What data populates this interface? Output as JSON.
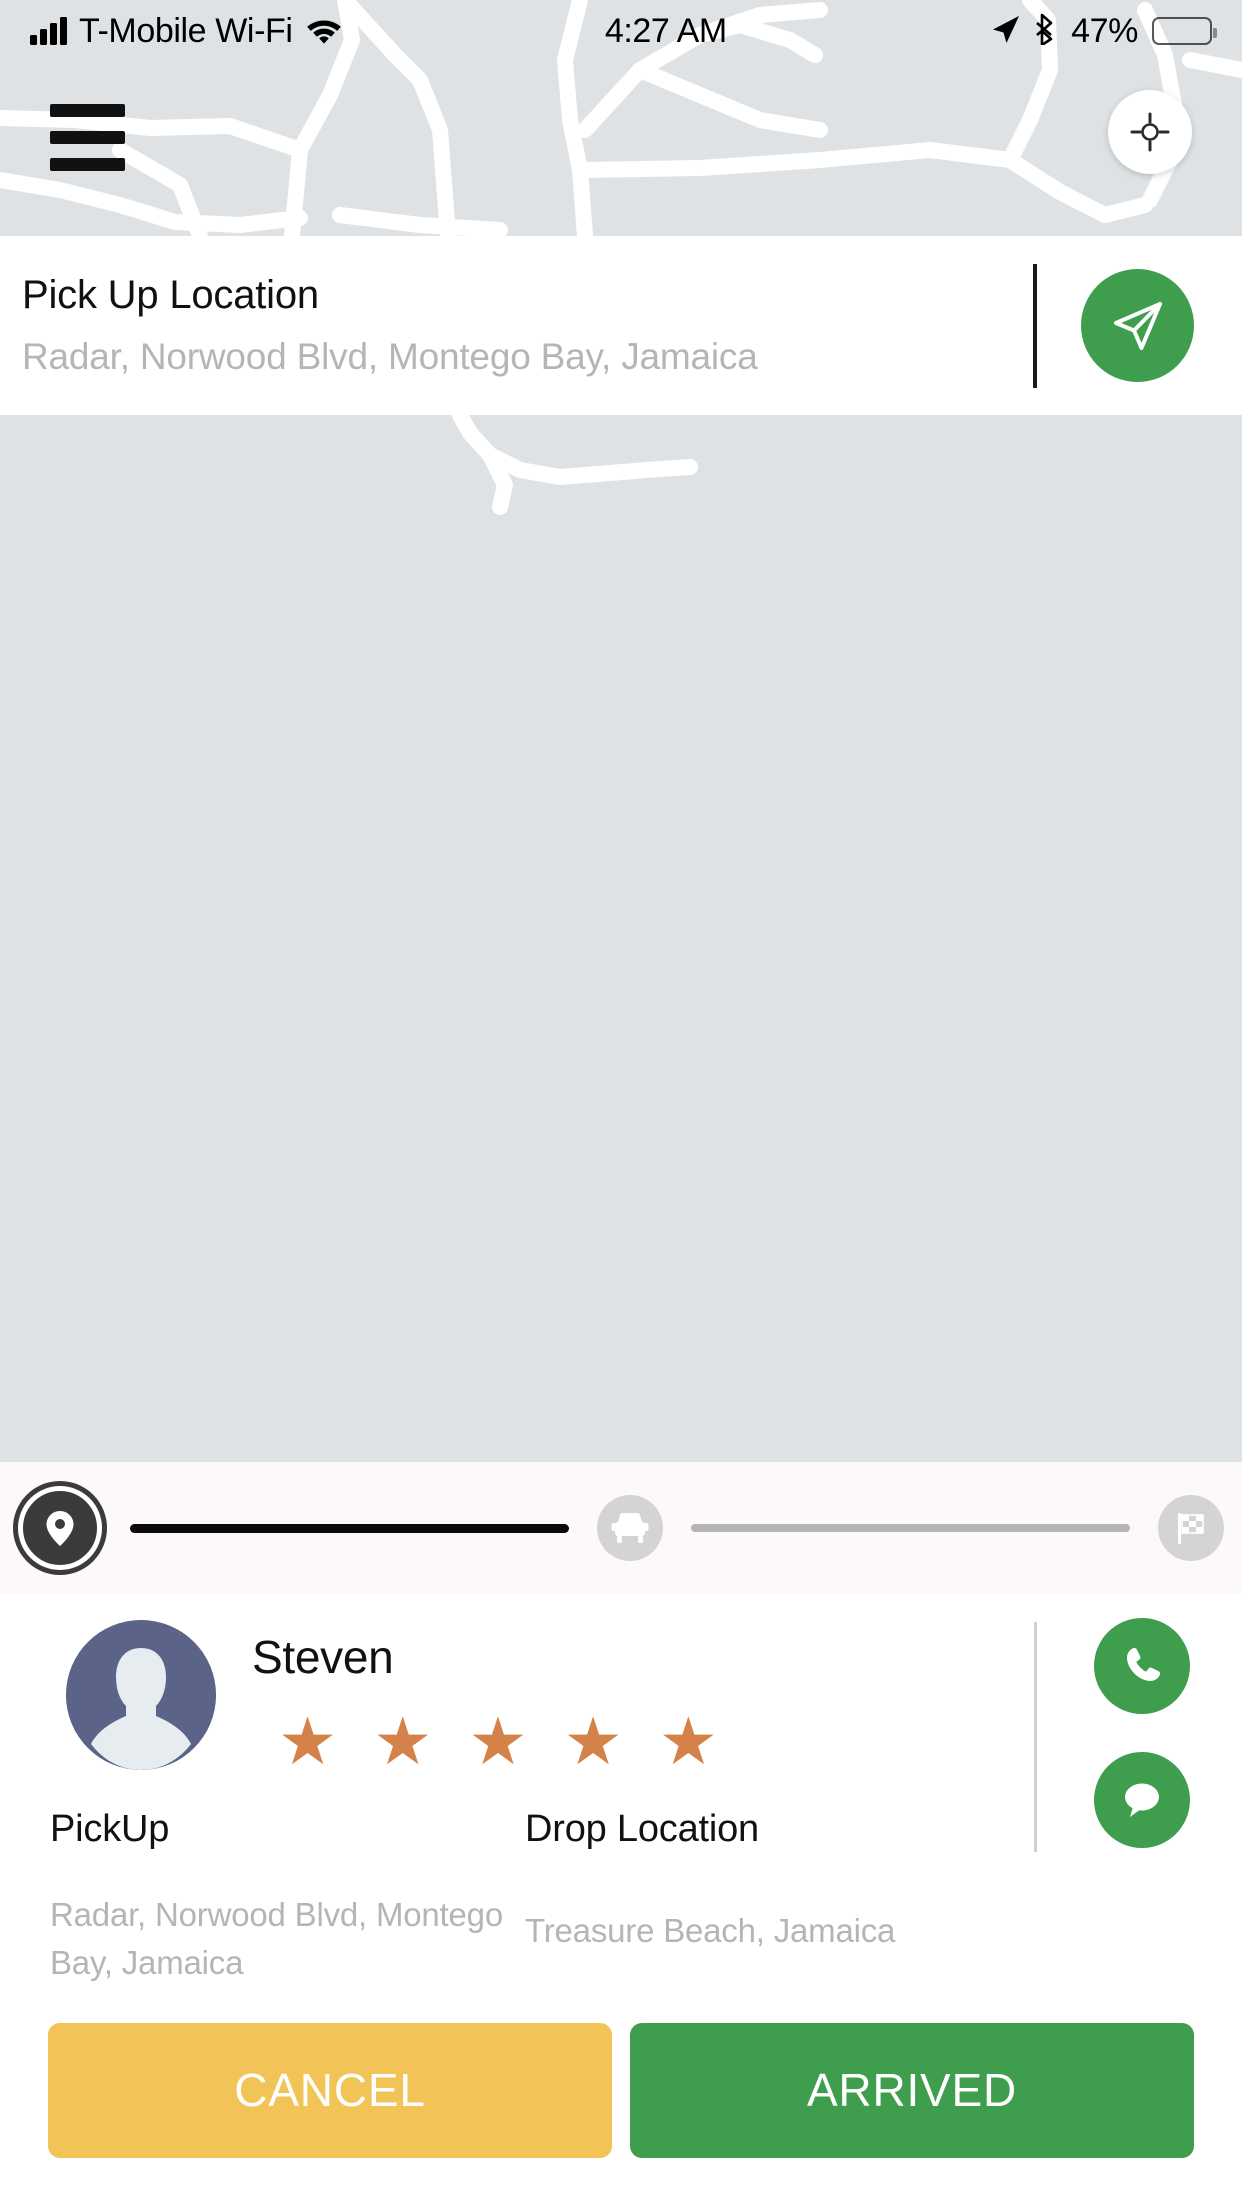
{
  "status_bar": {
    "carrier": "T-Mobile Wi-Fi",
    "time": "4:27 AM",
    "battery_percent": "47%",
    "battery_level": 47,
    "icons": [
      "signal-bars-icon",
      "wifi-icon",
      "location-arrow-icon",
      "bluetooth-icon",
      "battery-icon"
    ]
  },
  "map": {
    "menu_icon": "hamburger-menu-icon",
    "locate_icon": "crosshair-locate-icon",
    "background_color": "#dee2e4",
    "road_color": "#ffffff"
  },
  "pickup_card": {
    "title": "Pick Up Location",
    "address": "Radar, Norwood Blvd, Montego Bay, Jamaica",
    "nav_icon": "send-navigate-icon",
    "nav_color": "#3f9e4d"
  },
  "stepper": {
    "steps": [
      {
        "icon": "map-pin-icon",
        "state": "active"
      },
      {
        "icon": "car-icon",
        "state": "idle"
      },
      {
        "icon": "checkered-flag-icon",
        "state": "idle"
      }
    ],
    "connectors": [
      {
        "state": "done",
        "color": "#0a0a0a"
      },
      {
        "state": "todo",
        "color": "#b5b5b5"
      }
    ],
    "background_color": "#fdf8f9"
  },
  "driver": {
    "name": "Steven",
    "avatar_icon": "user-avatar-icon",
    "avatar_color": "#5b6388",
    "rating": 5,
    "rating_max": 5,
    "star_color": "#d4824a",
    "call_icon": "phone-icon",
    "message_icon": "chat-bubble-icon"
  },
  "trip": {
    "pickup_label": "PickUp",
    "pickup_address": "Radar, Norwood Blvd, Montego Bay, Jamaica",
    "drop_label": "Drop Location",
    "drop_address": "Treasure Beach, Jamaica"
  },
  "actions": {
    "cancel_label": "CANCEL",
    "cancel_color": "#f2c457",
    "arrived_label": "ARRIVED",
    "arrived_color": "#3f9e4d"
  }
}
